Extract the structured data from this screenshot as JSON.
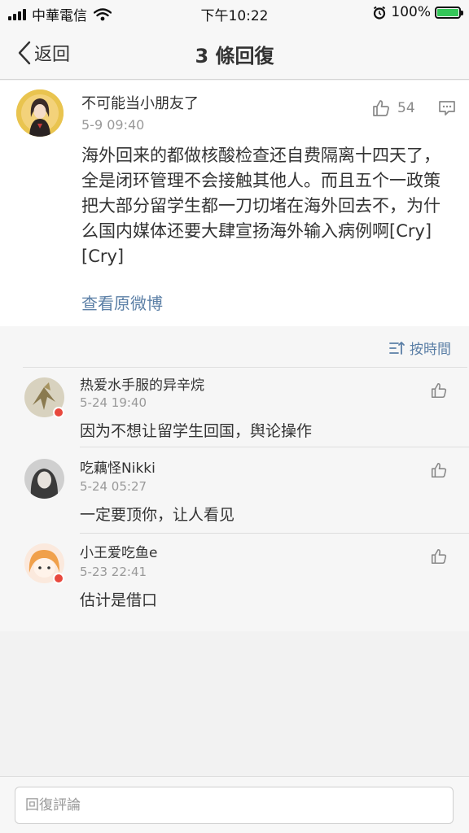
{
  "status_bar": {
    "carrier": "中華電信",
    "time": "下午10:22",
    "battery": "100%"
  },
  "nav": {
    "back_label": "返回",
    "title": "3 條回復"
  },
  "post": {
    "username": "不可能当小朋友了",
    "time": "5-9 09:40",
    "likes": "54",
    "content": "海外回来的都做核酸检查还自费隔离十四天了，全是闭环管理不会接触其他人。而且五个一政策把大部分留学生都一刀切堵在海外回去不，为什么国内媒体还要大肆宣扬海外输入病例啊[Cry][Cry]",
    "view_original": "查看原微博"
  },
  "sort": {
    "label": "按時間"
  },
  "replies": [
    {
      "username": "热爱水手服的异辛烷",
      "time": "5-24 19:40",
      "text": "因为不想让留学生回国，舆论操作"
    },
    {
      "username": "吃藕怪Nikki",
      "time": "5-24 05:27",
      "text": "一定要顶你，让人看见"
    },
    {
      "username": "小王爱吃鱼e",
      "time": "5-23 22:41",
      "text": "估计是借口"
    }
  ],
  "input": {
    "placeholder": "回復評論"
  },
  "colors": {
    "link": "#5b7fa6",
    "battery": "#34c759",
    "badge": "#e8483d"
  }
}
